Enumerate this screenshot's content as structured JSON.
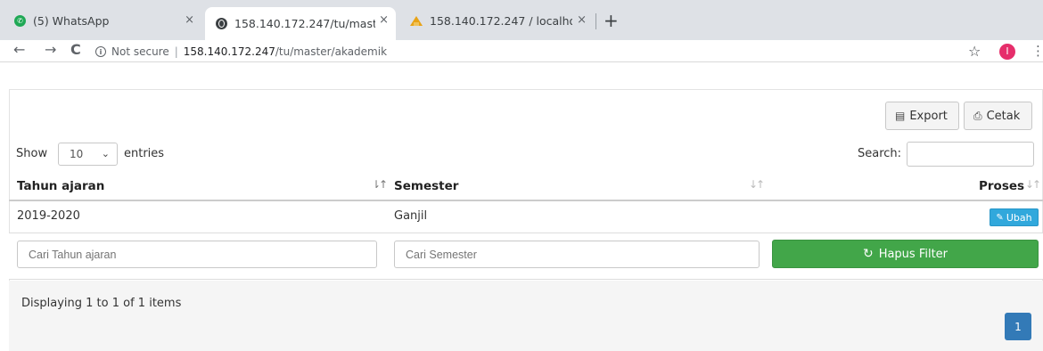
{
  "browser": {
    "tabs": [
      {
        "title": "(5) WhatsApp",
        "close": "×"
      },
      {
        "title": "158.140.172.247/tu/maste",
        "close": "×"
      },
      {
        "title": "158.140.172.247 / localhos",
        "close": "×"
      }
    ],
    "new_tab": "+",
    "back": "←",
    "forward": "→",
    "reload": "C",
    "security": "Not secure",
    "url_host": "158.140.172.247",
    "url_path": "/tu/master/akademik",
    "star": "☆",
    "profile_initial": "I",
    "menu": "⋮"
  },
  "toolbar": {
    "export_label": "Export",
    "cetak_label": "Cetak"
  },
  "table_controls": {
    "show_label": "Show",
    "page_length": "10",
    "entries_label": "entries",
    "search_label": "Search:"
  },
  "table": {
    "columns": [
      "Tahun ajaran",
      "Semester",
      "Proses"
    ],
    "rows": [
      {
        "tahun_ajaran": "2019-2020",
        "semester": "Ganjil",
        "action": "Ubah"
      }
    ]
  },
  "filters": {
    "tahun_placeholder": "Cari Tahun ajaran",
    "semester_placeholder": "Cari Semester",
    "reset_label": "Hapus Filter"
  },
  "footer": {
    "info": "Displaying 1 to 1 of 1 items",
    "current_page": "1"
  },
  "colors": {
    "primary": "#337ab7",
    "success": "#42a649",
    "info": "#31a8dc",
    "tabbar": "#dee1e6"
  }
}
